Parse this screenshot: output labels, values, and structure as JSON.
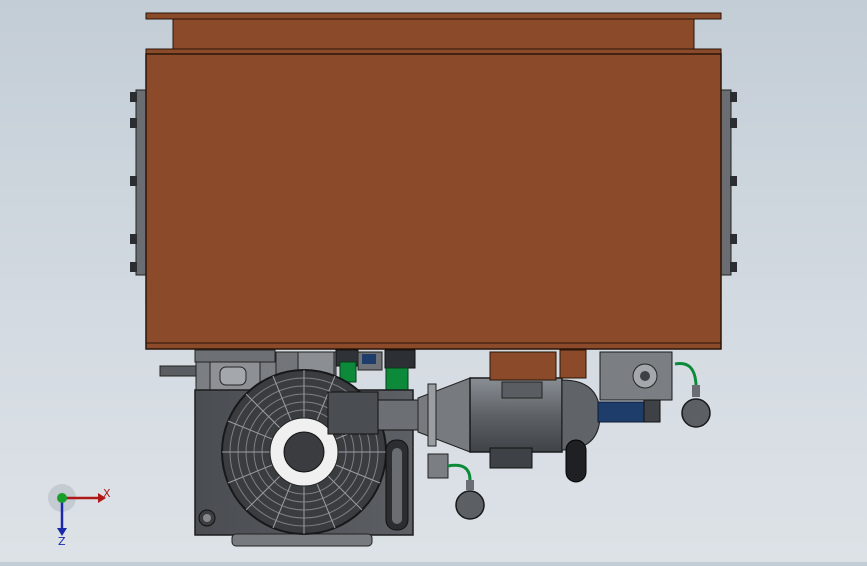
{
  "window": {
    "background_top": "#c3cdd6",
    "background_bottom": "#dde2e7"
  },
  "model": {
    "tank_color": "#8b4a29",
    "motor_color": "#6f7378",
    "hose_color": "#0c8a3a",
    "valve_blue": "#1f3d6b"
  },
  "triad": {
    "x_label": "X",
    "z_label": "Z",
    "x_color": "#b01818",
    "y_color": "#1aa02a",
    "z_color": "#1a2aa8"
  }
}
